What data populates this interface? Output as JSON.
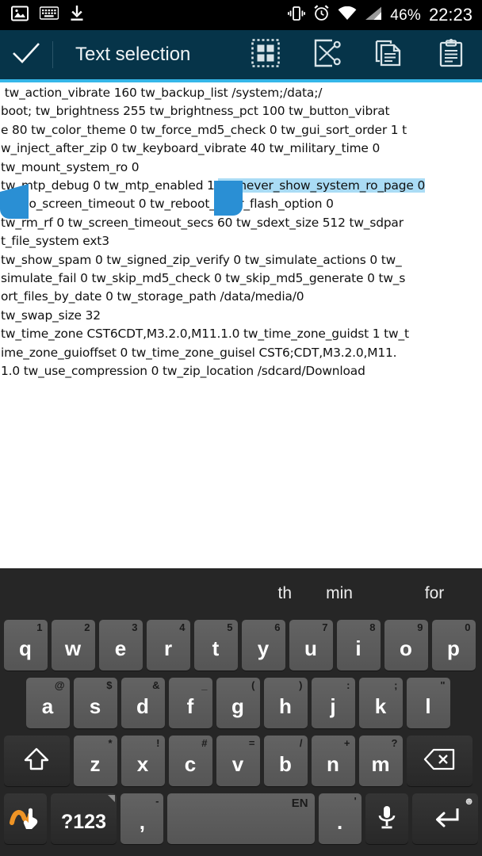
{
  "statusbar": {
    "icons_left": [
      "image-icon",
      "keyboard-icon",
      "download-icon"
    ],
    "icons_right": [
      "vibrate-icon",
      "alarm-icon",
      "wifi-icon",
      "signal-icon"
    ],
    "battery": "46%",
    "clock": "22:23"
  },
  "actionbar": {
    "done_icon": "check-icon",
    "title": "Text selection",
    "actions": [
      {
        "name": "select-all-icon",
        "label": "Select all"
      },
      {
        "name": "cut-icon",
        "label": "Cut"
      },
      {
        "name": "copy-icon",
        "label": "Copy"
      },
      {
        "name": "paste-icon",
        "label": "Paste"
      }
    ],
    "accent_color": "#35b6e8",
    "bar_color": "#063449"
  },
  "content": {
    "selection_color": "#aadcf5",
    "handle_color": "#2a8fd4",
    "lines": [
      " tw_action_vibrate 160 tw_backup_list /system;/data;/",
      "boot; tw_brightness 255 tw_brightness_pct 100 tw_button_vibrat",
      "e 80 tw_color_theme 0 tw_force_md5_check 0 tw_gui_sort_order 1 t",
      "w_inject_after_zip 0 tw_keyboard_vibrate 40 tw_military_time 0",
      "tw_mount_system_ro 0",
      "tw_no_screen_timeout 0 tw_reboot_after_flash_option 0",
      "tw_rm_rf 0 tw_screen_timeout_secs 60 tw_sdext_size 512 tw_sdpar",
      "t_file_system ext3",
      "tw_show_spam 0 tw_signed_zip_verify 0 tw_simulate_actions 0 tw_",
      "simulate_fail 0 tw_skip_md5_check 0 tw_skip_md5_generate 0 tw_s",
      "ort_files_by_date 0 tw_storage_path /data/media/0",
      "tw_swap_size 32",
      "tw_time_zone CST6CDT,M3.2.0,M11.1.0 tw_time_zone_guidst 1 tw_t",
      "ime_zone_guioffset 0 tw_time_zone_guisel CST6;CDT,M3.2.0,M11.",
      "1.0 tw_use_compression 0 tw_zip_location /sdcard/Download"
    ],
    "selected_line_index": 5,
    "selected_line_prefix": "tw_mtp_debug 0 tw_mtp_enabled 1 ",
    "selected_text": "tw_never_show_system_ro_page 0"
  },
  "keyboard": {
    "suggestions": [
      "th",
      "min",
      "for"
    ],
    "row1": [
      {
        "main": "q",
        "alt": "1"
      },
      {
        "main": "w",
        "alt": "2"
      },
      {
        "main": "e",
        "alt": "3"
      },
      {
        "main": "r",
        "alt": "4"
      },
      {
        "main": "t",
        "alt": "5"
      },
      {
        "main": "y",
        "alt": "6"
      },
      {
        "main": "u",
        "alt": "7"
      },
      {
        "main": "i",
        "alt": "8"
      },
      {
        "main": "o",
        "alt": "9"
      },
      {
        "main": "p",
        "alt": "0"
      }
    ],
    "row2": [
      {
        "main": "a",
        "alt": "@"
      },
      {
        "main": "s",
        "alt": "$"
      },
      {
        "main": "d",
        "alt": "&"
      },
      {
        "main": "f",
        "alt": "_"
      },
      {
        "main": "g",
        "alt": "("
      },
      {
        "main": "h",
        "alt": ")"
      },
      {
        "main": "j",
        "alt": ":"
      },
      {
        "main": "k",
        "alt": ";"
      },
      {
        "main": "l",
        "alt": "\""
      }
    ],
    "row3": [
      {
        "main": "z",
        "alt": "*"
      },
      {
        "main": "x",
        "alt": "!"
      },
      {
        "main": "c",
        "alt": "#"
      },
      {
        "main": "v",
        "alt": "="
      },
      {
        "main": "b",
        "alt": "/"
      },
      {
        "main": "n",
        "alt": "+"
      },
      {
        "main": "m",
        "alt": "?"
      }
    ],
    "shift_icon": "shift-icon",
    "backspace_icon": "backspace-icon",
    "swipe_icon": "swipe-gesture-icon",
    "symbols_label": "?123",
    "comma": {
      "main": ",",
      "alt": "-"
    },
    "space_label": "EN",
    "period": {
      "main": ".",
      "alt": "'"
    },
    "mic_icon": "microphone-icon",
    "enter_icon": "enter-icon",
    "emoji_icon": "smiley-icon"
  }
}
